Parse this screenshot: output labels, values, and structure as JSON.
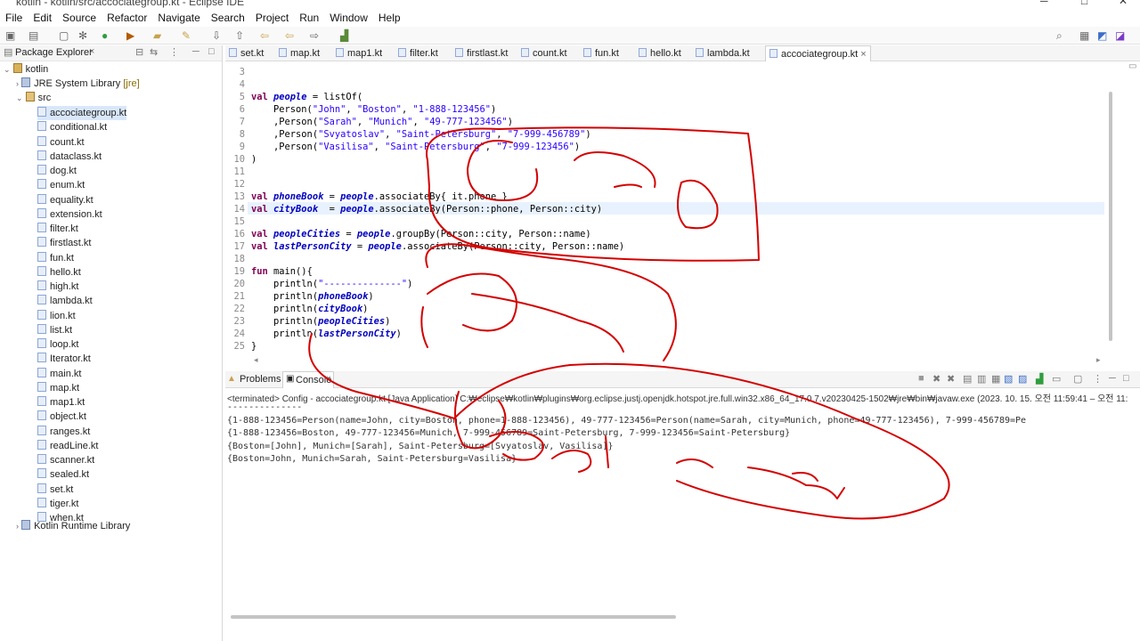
{
  "window": {
    "title": "kotlin - kotlin/src/accociategroup.kt - Eclipse IDE"
  },
  "menu": [
    "File",
    "Edit",
    "Source",
    "Refactor",
    "Navigate",
    "Search",
    "Project",
    "Run",
    "Window",
    "Help"
  ],
  "package_explorer": {
    "title": "Package Explorer",
    "project": "kotlin",
    "jre": "JRE System Library",
    "jre_tag": "[jre]",
    "src": "src",
    "files": [
      "accociategroup.kt",
      "conditional.kt",
      "count.kt",
      "dataclass.kt",
      "dog.kt",
      "enum.kt",
      "equality.kt",
      "extension.kt",
      "filter.kt",
      "firstlast.kt",
      "fun.kt",
      "hello.kt",
      "high.kt",
      "lambda.kt",
      "lion.kt",
      "list.kt",
      "loop.kt",
      "Iterator.kt",
      "main.kt",
      "map.kt",
      "map1.kt",
      "object.kt",
      "ranges.kt",
      "readLine.kt",
      "scanner.kt",
      "sealed.kt",
      "set.kt",
      "tiger.kt",
      "when.kt"
    ],
    "runtime": "Kotlin Runtime Library"
  },
  "editor_tabs": [
    "set.kt",
    "map.kt",
    "map1.kt",
    "filter.kt",
    "firstlast.kt",
    "count.kt",
    "fun.kt",
    "hello.kt",
    "lambda.kt",
    "accociategroup.kt"
  ],
  "line_numbers": [
    "3",
    "4",
    "5",
    "6",
    "7",
    "8",
    "9",
    "10",
    "11",
    "12",
    "13",
    "14",
    "15",
    "16",
    "17",
    "18",
    "19",
    "20",
    "21",
    "22",
    "23",
    "24",
    "25"
  ],
  "code": {
    "l5": [
      "val ",
      "people",
      " = listOf("
    ],
    "l6": [
      "    Person(",
      "\"John\"",
      ", ",
      "\"Boston\"",
      ", ",
      "\"1-888-123456\"",
      ")"
    ],
    "l7": [
      "    ,Person(",
      "\"Sarah\"",
      ", ",
      "\"Munich\"",
      ", ",
      "\"49-777-123456\"",
      ")"
    ],
    "l8": [
      "    ,Person(",
      "\"Svyatoslav\"",
      ", ",
      "\"Saint-Petersburg\"",
      ", ",
      "\"7-999-456789\"",
      ")"
    ],
    "l9": [
      "    ,Person(",
      "\"Vasilisa\"",
      ", ",
      "\"Saint-Petersburg\"",
      ", ",
      "\"7-999-123456\"",
      ")"
    ],
    "l10": ")",
    "l13": [
      "val ",
      "phoneBook",
      " = ",
      "people",
      ".associateBy{ it.phone }"
    ],
    "l14": [
      "val ",
      "cityBook",
      "  = ",
      "people",
      ".associateBy(Person::phone, Person::city)"
    ],
    "l16": [
      "val ",
      "peopleCities",
      " = ",
      "people",
      ".groupBy(Person::city, Person::name)"
    ],
    "l17": [
      "val ",
      "lastPersonCity",
      " = ",
      "people",
      ".associateBy(Person::city, Person::name)"
    ],
    "l19": [
      "fun ",
      "main(){"
    ],
    "l20": [
      "    println(",
      "\"--------------\"",
      ")"
    ],
    "l21": [
      "    println(",
      "phoneBook",
      ")"
    ],
    "l22": [
      "    println(",
      "cityBook",
      ")"
    ],
    "l23": [
      "    println(",
      "peopleCities",
      ")"
    ],
    "l24": [
      "    println(",
      "lastPersonCity",
      ")"
    ],
    "l25": "}"
  },
  "console": {
    "problems_tab": "Problems",
    "console_tab": "Console",
    "terminated": "<terminated> Config - accociategroup.kt [Java Application] C:₩eclipse₩kotlin₩plugins₩org.eclipse.justj.openjdk.hotspot.jre.full.win32.x86_64_17.0.7.v20230425-1502₩jre₩bin₩javaw.exe  (2023. 10. 15. 오전 11:59:41 – 오전 11:",
    "output": [
      "--------------",
      "{1-888-123456=Person(name=John, city=Boston, phone=1-888-123456), 49-777-123456=Person(name=Sarah, city=Munich, phone=49-777-123456), 7-999-456789=Pe",
      "{1-888-123456=Boston, 49-777-123456=Munich, 7-999-456789=Saint-Petersburg, 7-999-123456=Saint-Petersburg}",
      "{Boston=[John], Munich=[Sarah], Saint-Petersburg=[Svyatoslav, Vasilisa]}",
      "{Boston=John, Munich=Sarah, Saint-Petersburg=Vasilisa}"
    ]
  },
  "colors": {
    "keyword": "#7f0055",
    "string": "#2a00ff",
    "field": "#0000c0",
    "annotation_ink": "#d40000"
  }
}
